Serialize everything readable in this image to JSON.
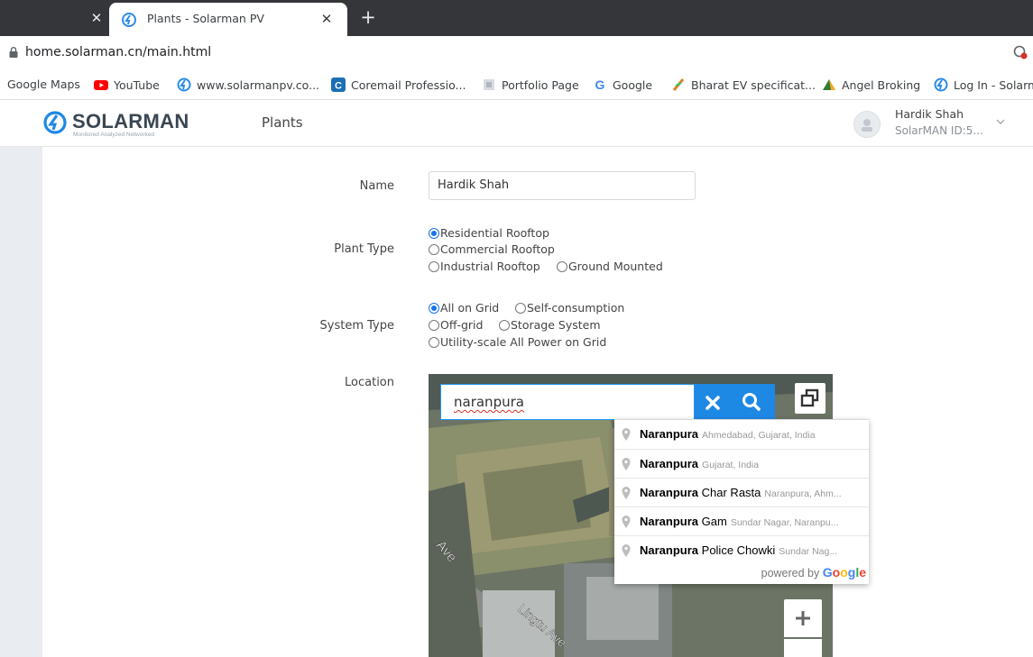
{
  "browser": {
    "tabs": [
      {
        "title": "Plants - Solarman PV"
      }
    ],
    "url": "home.solarman.cn/main.html",
    "bookmarks": [
      {
        "label": "Google Maps",
        "icon": "none"
      },
      {
        "label": "YouTube",
        "icon": "youtube-icon"
      },
      {
        "label": "www.solarmanpv.co...",
        "icon": "solarman-icon"
      },
      {
        "label": "Coremail Professio...",
        "icon": "coremail-icon"
      },
      {
        "label": "Portfolio Page",
        "icon": "portfolio-icon"
      },
      {
        "label": "Google",
        "icon": "google-icon"
      },
      {
        "label": "Bharat EV specificat...",
        "icon": "ev-icon"
      },
      {
        "label": "Angel Broking",
        "icon": "angel-icon"
      },
      {
        "label": "Log In - Solarm",
        "icon": "solarman-icon"
      }
    ]
  },
  "header": {
    "logo": "SOLARMAN",
    "logo_tagline": "Monitored  Analyzed  Networked",
    "nav": "Plants",
    "user_name": "Hardik Shah",
    "user_id": "SolarMAN ID:5..."
  },
  "form": {
    "name_label": "Name",
    "name_value": "Hardik Shah",
    "plant_type_label": "Plant Type",
    "plant_types": [
      {
        "label": "Residential Rooftop",
        "checked": true
      },
      {
        "label": "Commercial Rooftop",
        "checked": false
      },
      {
        "label": "Industrial Rooftop",
        "checked": false
      },
      {
        "label": "Ground Mounted",
        "checked": false
      }
    ],
    "system_type_label": "System Type",
    "system_types": [
      {
        "label": "All on Grid",
        "checked": true
      },
      {
        "label": "Self-consumption",
        "checked": false
      },
      {
        "label": "Off-grid",
        "checked": false
      },
      {
        "label": "Storage System",
        "checked": false
      },
      {
        "label": "Utility-scale All Power on Grid",
        "checked": false
      }
    ],
    "location_label": "Location"
  },
  "map": {
    "search_query": "naranpura",
    "street_labels": [
      "Ave",
      "Lingtu Ave"
    ],
    "suggestions": [
      {
        "main": "Naranpura",
        "extra": "",
        "secondary": "Ahmedabad, Gujarat, India"
      },
      {
        "main": "Naranpura",
        "extra": "",
        "secondary": "Gujarat, India"
      },
      {
        "main": "Naranpura",
        "extra": " Char Rasta",
        "secondary": "Naranpura, Ahm..."
      },
      {
        "main": "Naranpura",
        "extra": " Gam",
        "secondary": "Sundar Nagar, Naranpu..."
      },
      {
        "main": "Naranpura",
        "extra": " Police Chowki",
        "secondary": "Sundar Nag..."
      }
    ],
    "powered_by": "powered by",
    "powered_brand": "Google"
  },
  "colors": {
    "accent": "#1e88e5",
    "chrome_dark": "#35363a",
    "sidebar": "#e9ecf1"
  }
}
